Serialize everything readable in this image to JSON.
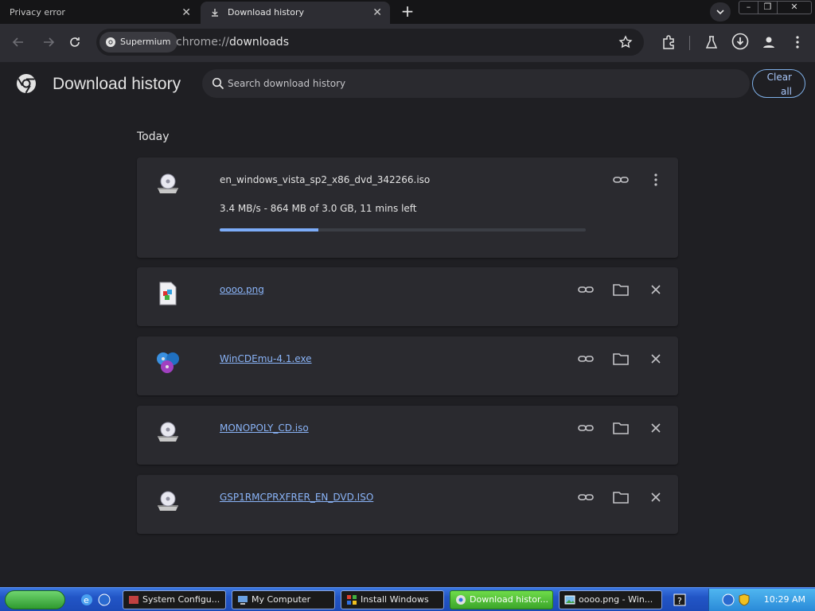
{
  "tabs": [
    {
      "title": "Privacy error"
    },
    {
      "title": "Download history"
    }
  ],
  "window_controls": {
    "minimize": "–",
    "restore": "❐",
    "close": "✕"
  },
  "omnibox": {
    "chip": "Supermium",
    "url_scheme": "chrome://",
    "url_host": "downloads"
  },
  "page": {
    "title": "Download history",
    "search_placeholder": "Search download history",
    "clear_all": "Clear all",
    "section_date": "Today"
  },
  "downloads": [
    {
      "name": "en_windows_vista_sp2_x86_dvd_342266.iso",
      "status": "3.4 MB/s - 864 MB of 3.0 GB, 11 mins left",
      "progress": 0.27,
      "icon": "disc-iso-icon",
      "in_progress": true
    },
    {
      "name": "oooo.png",
      "icon": "png-file-icon",
      "in_progress": false
    },
    {
      "name": "WinCDEmu-4.1.exe",
      "icon": "wincdemu-icon",
      "in_progress": false
    },
    {
      "name": "MONOPOLY_CD.iso",
      "icon": "disc-iso-icon",
      "in_progress": false
    },
    {
      "name": "GSP1RMCPRXFRER_EN_DVD.ISO",
      "icon": "disc-iso-icon",
      "in_progress": false
    }
  ],
  "taskbar": {
    "items": [
      {
        "label": "System Configu..."
      },
      {
        "label": "My Computer"
      },
      {
        "label": "Install Windows"
      },
      {
        "label": "Download histor..."
      },
      {
        "label": "oooo.png - Win..."
      }
    ],
    "clock": "10:29 AM"
  },
  "colors": {
    "accent": "#8ab4f8",
    "progress": "#7cacf8",
    "background": "#1f1f23",
    "card": "#2a2a2f"
  }
}
